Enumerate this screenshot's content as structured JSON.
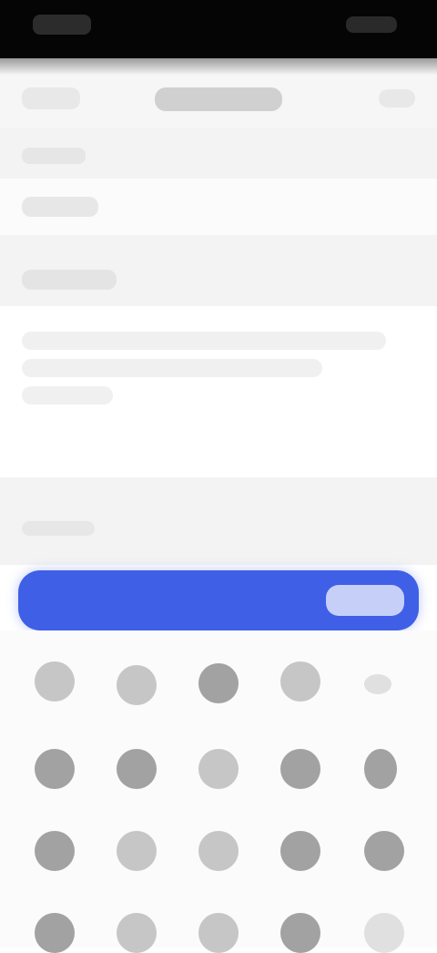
{
  "status_bar": {
    "time": "",
    "icons": [
      "signal-icon",
      "wifi-icon",
      "battery-icon"
    ]
  },
  "header": {
    "left_action": "",
    "title": "",
    "right_action": ""
  },
  "form": {
    "field1_label": "",
    "field1_value": "",
    "field2_label": "",
    "field2_value": "",
    "hint": ""
  },
  "keyboard": {
    "suggestion_text": "",
    "action_label": ""
  },
  "colors": {
    "accent": "#3f5fe6",
    "status_bar": "#050505",
    "form_bg": "#f3f3f3"
  }
}
